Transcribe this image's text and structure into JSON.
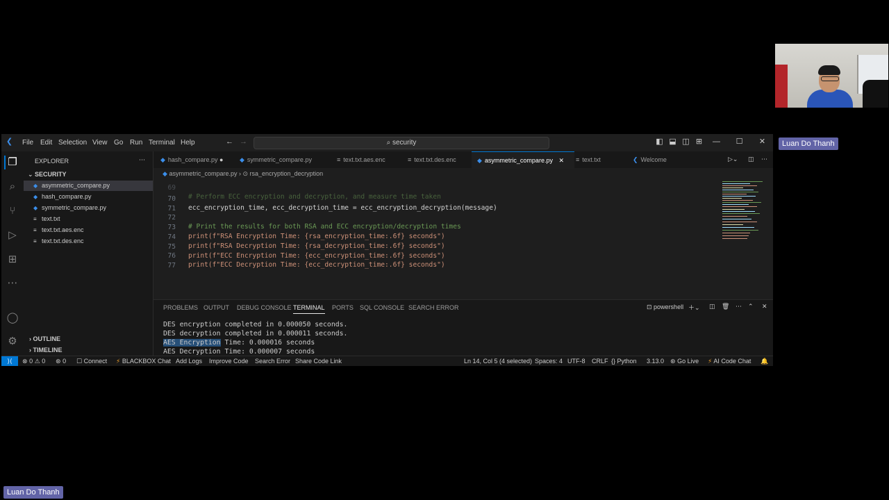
{
  "participants": {
    "main_name": "Luan Do Thanh",
    "self_name": "Luan Do Thanh"
  },
  "window": {
    "menu": [
      "File",
      "Edit",
      "Selection",
      "View",
      "Go",
      "Run",
      "Terminal",
      "Help"
    ],
    "search": "security"
  },
  "sidebar": {
    "title": "EXPLORER",
    "folder": "SECURITY",
    "files": [
      {
        "name": "asymmetric_compare.py",
        "icon": "python-icon",
        "selected": true
      },
      {
        "name": "hash_compare.py",
        "icon": "python-icon"
      },
      {
        "name": "symmetric_compare.py",
        "icon": "python-icon"
      },
      {
        "name": "text.txt",
        "icon": "text-file-icon"
      },
      {
        "name": "text.txt.aes.enc",
        "icon": "text-file-icon"
      },
      {
        "name": "text.txt.des.enc",
        "icon": "text-file-icon"
      }
    ],
    "outline": "OUTLINE",
    "timeline": "TIMELINE"
  },
  "tabs": [
    {
      "label": "hash_compare.py",
      "icon": "python-icon",
      "modified": true
    },
    {
      "label": "symmetric_compare.py",
      "icon": "python-icon"
    },
    {
      "label": "text.txt.aes.enc",
      "icon": "text-file-icon"
    },
    {
      "label": "text.txt.des.enc",
      "icon": "text-file-icon"
    },
    {
      "label": "asymmetric_compare.py",
      "icon": "python-icon",
      "active": true
    },
    {
      "label": "text.txt",
      "icon": "text-file-icon"
    },
    {
      "label": "Welcome",
      "icon": "vscode-icon"
    }
  ],
  "breadcrumb": {
    "file": "asymmetric_compare.py",
    "symbol": "rsa_encryption_decryption"
  },
  "editor": {
    "partial_top": "# Perform ECC encryption and decryption, and measure time taken",
    "lines": [
      {
        "n": "70",
        "text": "ecc_encryption_time, ecc_decryption_time = ecc_encryption_decryption(message)"
      },
      {
        "n": "71",
        "text": ""
      },
      {
        "n": "72",
        "text": "# Print the results for both RSA and ECC encryption/decryption times"
      },
      {
        "n": "73",
        "text": "print(f\"RSA Encryption Time: {rsa_encryption_time:.6f} seconds\")"
      },
      {
        "n": "74",
        "text": "print(f\"RSA Decryption Time: {rsa_decryption_time:.6f} seconds\")"
      },
      {
        "n": "75",
        "text": "print(f\"ECC Encryption Time: {ecc_encryption_time:.6f} seconds\")"
      },
      {
        "n": "76",
        "text": "print(f\"ECC Decryption Time: {ecc_decryption_time:.6f} seconds\")"
      },
      {
        "n": "77",
        "text": ""
      }
    ]
  },
  "panel": {
    "tabs": [
      "PROBLEMS",
      "OUTPUT",
      "DEBUG CONSOLE",
      "TERMINAL",
      "PORTS",
      "SQL CONSOLE",
      "SEARCH ERROR"
    ],
    "active_tab": "TERMINAL",
    "shell": "powershell",
    "terminal": [
      "DES encryption completed in 0.000050 seconds.",
      "DES decryption completed in 0.000011 seconds.",
      "AES Encryption Time: 0.000016 seconds",
      "AES Decryption Time: 0.000007 seconds"
    ],
    "selected_text": "AES Encryption"
  },
  "status": {
    "errors": "0",
    "warnings": "0",
    "ports": "0",
    "connect": "Connect",
    "blackbox": "BLACKBOX Chat",
    "add_logs": "Add Logs",
    "improve": "Improve Code",
    "search_error": "Search Error",
    "share": "Share Code Link",
    "position": "Ln 14, Col 5 (4 selected)",
    "spaces": "Spaces: 4",
    "encoding": "UTF-8",
    "eol": "CRLF",
    "language": "Python",
    "version": "3.13.0",
    "golive": "Go Live",
    "aichat": "AI Code Chat"
  },
  "colors": {
    "accent": "#0078d4",
    "meeting_tag": "#6264a7",
    "python_icon": "#3b8eea"
  }
}
